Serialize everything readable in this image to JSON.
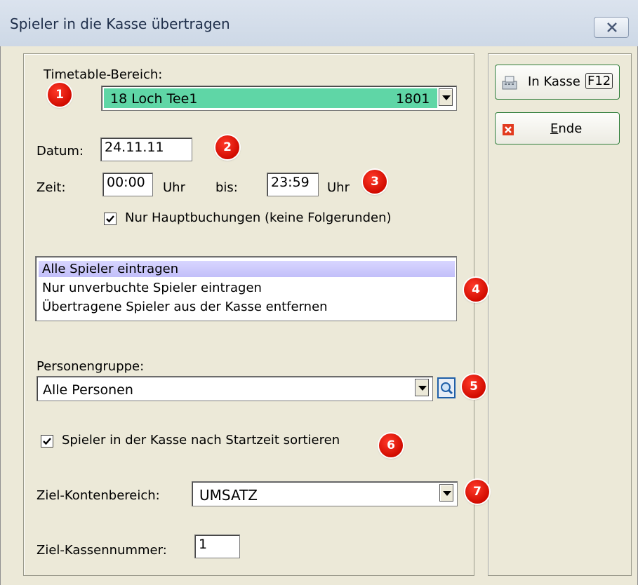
{
  "window": {
    "title": "Spieler in die Kasse übertragen",
    "close_icon": "close-icon"
  },
  "timetable": {
    "label": "Timetable-Bereich:",
    "selected_name": "18 Loch Tee1",
    "selected_code": "1801",
    "selected_bg": "#5fd6a6"
  },
  "date": {
    "label": "Datum:",
    "value": "24.11.11"
  },
  "time": {
    "label": "Zeit:",
    "from_value": "00:00",
    "unit": "Uhr",
    "to_label": "bis:",
    "to_value": "23:59",
    "unit2": "Uhr"
  },
  "main_bookings": {
    "checked": true,
    "label": "Nur Hauptbuchungen (keine Folgerunden)"
  },
  "mode_list": {
    "items": [
      "Alle Spieler eintragen",
      "Nur unverbuchte Spieler eintragen",
      "Übertragene Spieler aus der Kasse entfernen"
    ],
    "selected_index": 0
  },
  "person_group": {
    "label": "Personengruppe:",
    "value": "Alle Personen",
    "search_icon": "search-icon"
  },
  "sort_option": {
    "checked": true,
    "label": "Spieler in der Kasse nach Startzeit sortieren"
  },
  "target_account": {
    "label": "Ziel-Kontenbereich:",
    "value": "UMSATZ"
  },
  "target_register": {
    "label": "Ziel-Kassennummer:",
    "value": "1"
  },
  "actions": {
    "to_register_label": "In Kasse",
    "to_register_shortcut": "F12",
    "to_register_icon": "cash-register-icon",
    "end_label_underlined": "E",
    "end_label_rest": "nde",
    "end_icon": "red-x-icon"
  },
  "badges": [
    "1",
    "2",
    "3",
    "4",
    "5",
    "6",
    "7"
  ],
  "colors": {
    "badge": "#e01a0c",
    "selection": "#c9c6fb",
    "window_bg": "#ece9d8",
    "button_border": "#2e7d3a"
  }
}
